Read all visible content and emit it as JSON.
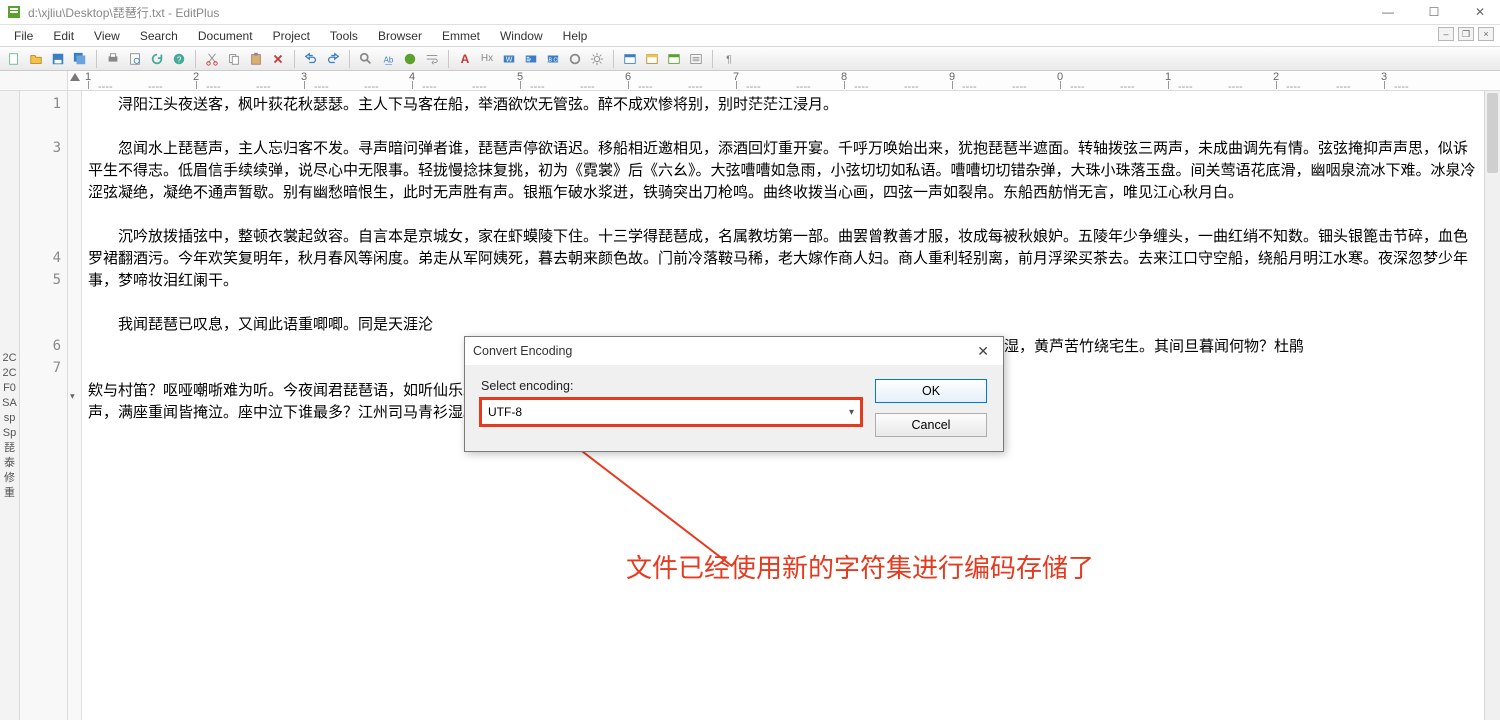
{
  "window": {
    "title": "d:\\xjliu\\Desktop\\琵琶行.txt - EditPlus",
    "minimize": "—",
    "maximize": "☐",
    "close": "✕"
  },
  "menus": [
    "File",
    "Edit",
    "View",
    "Search",
    "Document",
    "Project",
    "Tools",
    "Browser",
    "Emmet",
    "Window",
    "Help"
  ],
  "ruler": {
    "marks": [
      1,
      2,
      3,
      4,
      5,
      6,
      7,
      8,
      9,
      0,
      1,
      2,
      3
    ]
  },
  "line_numbers": [
    "1",
    "",
    "3",
    "",
    "",
    "",
    "4",
    "5",
    "",
    "",
    "6",
    "7",
    "",
    "",
    ""
  ],
  "side_tabs": [
    "2C",
    "2C",
    "F0",
    "SA",
    "sp",
    "Sp",
    "琵",
    "泰",
    "修",
    "",
    "重"
  ],
  "document": {
    "para1": "浔阳江头夜送客，枫叶荻花秋瑟瑟。主人下马客在船，举酒欲饮无管弦。醉不成欢惨将别，别时茫茫江浸月。",
    "para3": "忽闻水上琵琶声，主人忘归客不发。寻声暗问弹者谁，琵琶声停欲语迟。移船相近邀相见，添酒回灯重开宴。千呼万唤始出来，犹抱琵琶半遮面。转轴拨弦三两声，未成曲调先有情。弦弦掩抑声声思，似诉平生不得志。低眉信手续续弹，说尽心中无限事。轻拢慢捻抹复挑，初为《霓裳》后《六幺》。大弦嘈嘈如急雨，小弦切切如私语。嘈嘈切切错杂弹，大珠小珠落玉盘。间关莺语花底滑，幽咽泉流冰下难。冰泉冷涩弦凝绝，凝绝不通声暂歇。别有幽愁暗恨生，此时无声胜有声。银瓶乍破水浆迸，铁骑突出刀枪鸣。曲终收拨当心画，四弦一声如裂帛。东船西舫悄无言，唯见江心秋月白。",
    "para5": "沉吟放拨插弦中，整顿衣裳起敛容。自言本是京城女，家在虾蟆陵下住。十三学得琵琶成，名属教坊第一部。曲罢曾教善才服，妆成每被秋娘妒。五陵年少争缠头，一曲红绡不知数。钿头银篦击节碎，血色罗裙翻酒污。今年欢笑复明年，秋月春风等闲度。弟走从军阿姨死，暮去朝来颜色故。门前冷落鞍马稀，老大嫁作商人妇。商人重利轻别离，前月浮梁买茶去。去来江口守空船，绕船月明江水寒。夜深忽梦少年事，梦啼妆泪红阑干。",
    "para7_a": "我闻琵琶已叹息，又闻此语重唧唧。同是天涯沦",
    "para7_b": "戉。浔阳地僻无音乐，终岁不闻丝竹声。住近湓江地低湿，黄芦苦竹绕宅生。其间旦暮闻何物？杜鹃",
    "para7_c": "欸与村笛？呕哑嘲哳难为听。今夜闻君琵琶语，如听仙乐耳暂明。莫辞更坐弹一曲，为君翻作《琵琶",
    "para7_d": "声，满座重闻皆掩泣。座中泣下谁最多？江州司马青衫湿。"
  },
  "dialog": {
    "title": "Convert Encoding",
    "close": "✕",
    "label": "Select encoding:",
    "value": "UTF-8",
    "ok": "OK",
    "cancel": "Cancel"
  },
  "annotation": "文件已经使用新的字符集进行编码存储了",
  "toolbar_icons": [
    "new",
    "open",
    "save",
    "save-all",
    "print",
    "preview",
    "reload",
    "help",
    "cut",
    "copy",
    "paste",
    "delete",
    "undo",
    "redo",
    "find",
    "find-in-files",
    "browser",
    "word-wrap",
    "font-large",
    "hex",
    "bold",
    "indent-guide",
    "code",
    "spell",
    "settings",
    "show-hidden",
    "show-browser",
    "toggle",
    "directory",
    "terminal"
  ]
}
